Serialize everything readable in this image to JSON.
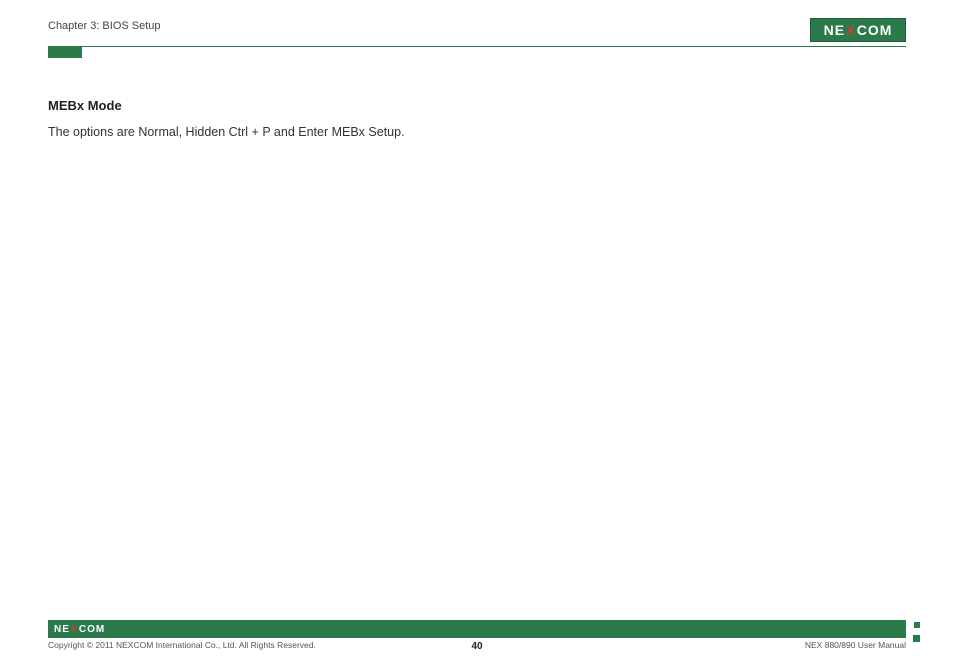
{
  "header": {
    "chapter": "Chapter 3: BIOS Setup",
    "logo_left": "NE",
    "logo_x": "X",
    "logo_right": "COM"
  },
  "content": {
    "section_title": "MEBx Mode",
    "body": "The options are Normal, Hidden Ctrl + P and Enter MEBx Setup."
  },
  "footer": {
    "logo_left": "NE",
    "logo_x": "X",
    "logo_right": "COM",
    "copyright": "Copyright © 2011 NEXCOM International Co., Ltd. All Rights Reserved.",
    "page_number": "40",
    "doc_ref": "NEX 880/890 User Manual"
  }
}
